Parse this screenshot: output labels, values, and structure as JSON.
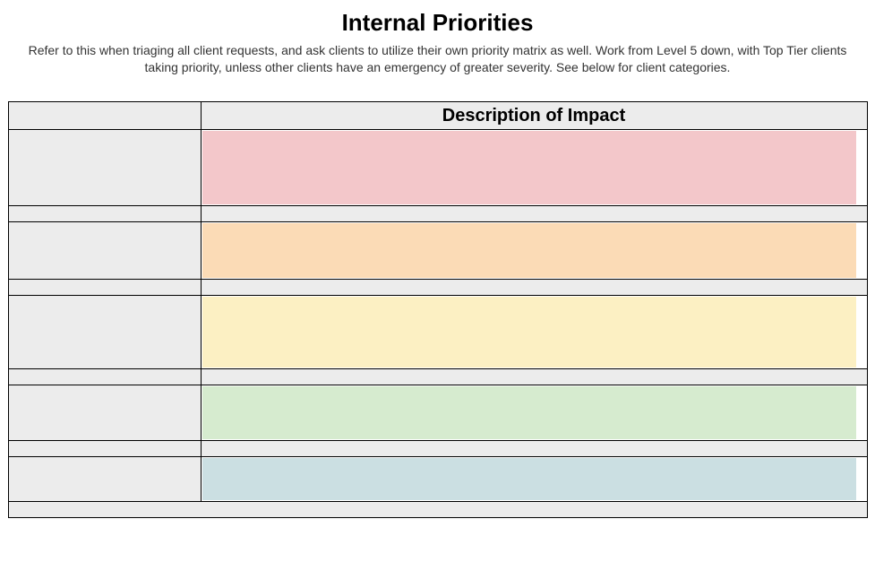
{
  "title": "Internal Priorities",
  "subtitle": "Refer to this when triaging all client requests, and ask clients to utilize their own priority matrix as well. Work from Level 5 down, with Top Tier clients taking priority, unless other clients have an emergency of greater severity. See below for client categories.",
  "table": {
    "header_left": "",
    "header_right": "Description of Impact",
    "levels": [
      {
        "label": "",
        "color": "#f3c7ca",
        "height_class": "h-85"
      },
      {
        "label": "",
        "color": "#fbdbb6",
        "height_class": "h-64"
      },
      {
        "label": "",
        "color": "#fcf0c3",
        "height_class": "h-82"
      },
      {
        "label": "",
        "color": "#d6ebcf",
        "height_class": "h-62"
      },
      {
        "label": "",
        "color": "#cbdfe2",
        "height_class": "h-50"
      }
    ]
  }
}
